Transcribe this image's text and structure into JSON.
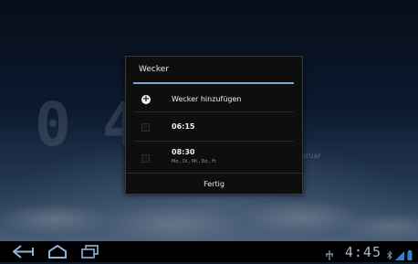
{
  "background": {
    "clock_text": "0445",
    "date_text": "bruar"
  },
  "dialog": {
    "title": "Wecker",
    "add_alarm_label": "Wecker hinzufügen",
    "alarms": [
      {
        "time": "06:15",
        "days": ""
      },
      {
        "time": "08:30",
        "days": "Mo., Di., Mi., Do., Fr."
      }
    ],
    "done_label": "Fertig"
  },
  "status_bar": {
    "time": "4:45"
  },
  "colors": {
    "accent": "#7fa9cf",
    "dialog_bg": "#0e0e0e",
    "navbar_bg": "#000000"
  },
  "icons": {
    "nav": [
      "back-icon",
      "home-icon",
      "recent-apps-icon"
    ],
    "status": [
      "usb-debug-icon",
      "bluetooth-icon",
      "wifi-signal-icon",
      "battery-icon"
    ]
  }
}
